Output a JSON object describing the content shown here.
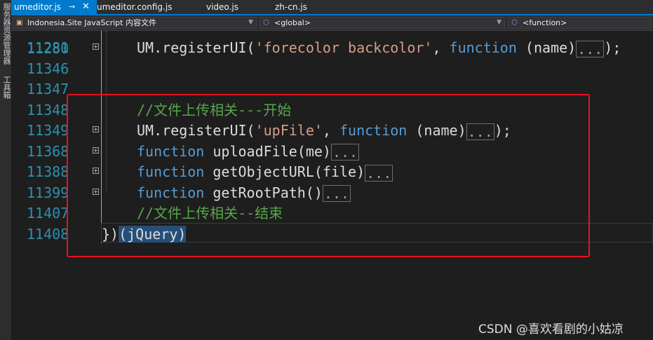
{
  "side_tools": [
    "服务器资源管理器",
    "工具箱"
  ],
  "tabs": [
    {
      "label": "umeditor.js",
      "active": true
    },
    {
      "label": "umeditor.config.js",
      "active": false
    },
    {
      "label": "video.js",
      "active": false
    },
    {
      "label": "zh-cn.js",
      "active": false
    }
  ],
  "nav": {
    "project": "Indonesia.Site JavaScript 内容文件",
    "scope": "<global>",
    "member": "<function>"
  },
  "editor": {
    "partial_line_number": "11280",
    "lines": [
      {
        "num": "11281",
        "fold": true,
        "tokens": [
          {
            "t": "UM.registerUI(",
            "c": ""
          },
          {
            "t": "'forecolor backcolor'",
            "c": "str"
          },
          {
            "t": ", ",
            "c": ""
          },
          {
            "t": "function",
            "c": "kw"
          },
          {
            "t": " (name)",
            "c": ""
          },
          {
            "t": "...",
            "c": "box"
          },
          {
            "t": ");",
            "c": ""
          }
        ]
      },
      {
        "num": "11346",
        "fold": false,
        "tokens": []
      },
      {
        "num": "11347",
        "fold": false,
        "tokens": []
      },
      {
        "num": "11348",
        "fold": false,
        "tokens": [
          {
            "t": "//文件上传相关---开始",
            "c": "cm"
          }
        ]
      },
      {
        "num": "11349",
        "fold": true,
        "tokens": [
          {
            "t": "UM.registerUI(",
            "c": ""
          },
          {
            "t": "'upFile'",
            "c": "str"
          },
          {
            "t": ", ",
            "c": ""
          },
          {
            "t": "function",
            "c": "kw"
          },
          {
            "t": " (name)",
            "c": ""
          },
          {
            "t": "...",
            "c": "box"
          },
          {
            "t": ");",
            "c": ""
          }
        ]
      },
      {
        "num": "11368",
        "fold": true,
        "tokens": [
          {
            "t": "function",
            "c": "kw"
          },
          {
            "t": " uploadFile(me)",
            "c": ""
          },
          {
            "t": "...",
            "c": "box"
          }
        ]
      },
      {
        "num": "11388",
        "fold": true,
        "tokens": [
          {
            "t": "function",
            "c": "kw"
          },
          {
            "t": " getObjectURL(file)",
            "c": ""
          },
          {
            "t": "...",
            "c": "box"
          }
        ]
      },
      {
        "num": "11399",
        "fold": true,
        "tokens": [
          {
            "t": "function",
            "c": "kw"
          },
          {
            "t": " getRootPath()",
            "c": ""
          },
          {
            "t": "...",
            "c": "box"
          }
        ]
      },
      {
        "num": "11407",
        "fold": false,
        "tokens": [
          {
            "t": "//文件上传相关--结束",
            "c": "cm"
          }
        ]
      },
      {
        "num": "11408",
        "fold": false,
        "closing": true,
        "tokens": [
          {
            "t": "})",
            "c": ""
          },
          {
            "t": "(jQuery)",
            "c": "hl"
          }
        ]
      }
    ]
  },
  "watermark": "CSDN @喜欢看剧的小姑凉",
  "colors": {
    "accent": "#007acc",
    "highlight_box": "#e81123",
    "keyword": "#569cd6",
    "string": "#d69d85",
    "comment": "#57a64a",
    "line_number": "#2b91af"
  }
}
